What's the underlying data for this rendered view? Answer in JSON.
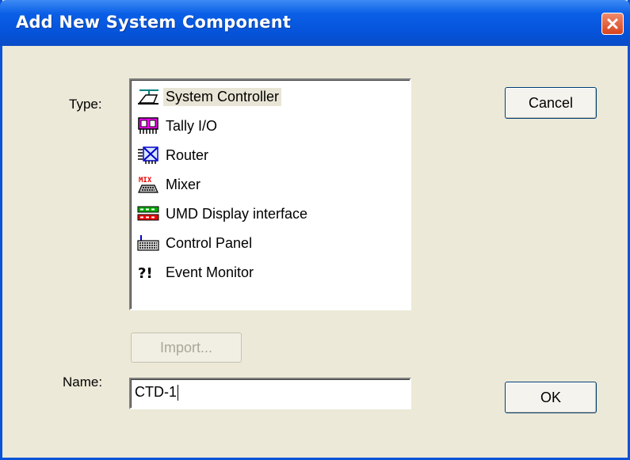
{
  "window": {
    "title": "Add New System Component",
    "close_icon": "close-icon",
    "colors": {
      "titlebar": "#0552d8",
      "close": "#d7431d",
      "dialog_bg": "#ece9d8"
    }
  },
  "type_label": "Type:",
  "name_label": "Name:",
  "component_types": [
    {
      "label": "System Controller",
      "icon": "system-controller-icon",
      "selected": true
    },
    {
      "label": "Tally I/O",
      "icon": "tally-io-icon",
      "selected": false
    },
    {
      "label": "Router",
      "icon": "router-icon",
      "selected": false
    },
    {
      "label": "Mixer",
      "icon": "mixer-icon",
      "selected": false
    },
    {
      "label": "UMD Display interface",
      "icon": "umd-display-icon",
      "selected": false
    },
    {
      "label": "Control Panel",
      "icon": "control-panel-icon",
      "selected": false
    },
    {
      "label": "Event Monitor",
      "icon": "event-monitor-icon",
      "selected": false
    }
  ],
  "buttons": {
    "cancel": "Cancel",
    "ok": "OK",
    "import": "Import...",
    "import_enabled": false
  },
  "name_input": {
    "value": "CTD-1"
  }
}
